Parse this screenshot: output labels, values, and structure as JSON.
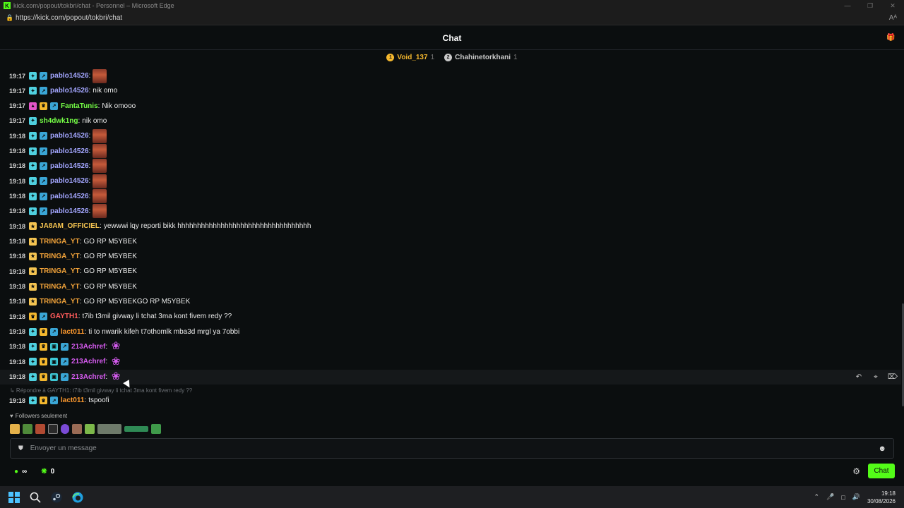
{
  "window": {
    "title": "kick.com/popout/tokbri/chat - Personnel – Microsoft Edge",
    "url": "https://kick.com/popout/tokbri/chat",
    "reader_label": "Aᴬ"
  },
  "header": {
    "title": "Chat"
  },
  "leaderboard": [
    {
      "rank": "1",
      "name": "Void_137",
      "count": "1",
      "color": "#f5b82e"
    },
    {
      "rank": "2",
      "name": "Chahinetorkhani",
      "count": "1",
      "color": "#c9c9c9"
    }
  ],
  "messages": [
    {
      "time": "19:17",
      "user": "pablo14526",
      "text": "",
      "emote": "tile",
      "badges": [
        "sub",
        "vip"
      ],
      "color": "#a3a6ff"
    },
    {
      "time": "19:17",
      "user": "pablo14526",
      "text": "nik omo",
      "emote": "",
      "badges": [
        "sub",
        "vip"
      ],
      "color": "#a3a6ff"
    },
    {
      "time": "19:17",
      "user": "FantaTunis",
      "text": "Nik omooo",
      "emote": "",
      "badges": [
        "gift",
        "crown",
        "vip"
      ],
      "color": "#75fd46"
    },
    {
      "time": "19:17",
      "user": "sh4dwk1ng",
      "text": "nik omo",
      "emote": "",
      "badges": [
        "sub"
      ],
      "color": "#75fd46"
    },
    {
      "time": "19:18",
      "user": "pablo14526",
      "text": "",
      "emote": "tile",
      "badges": [
        "sub",
        "vip"
      ],
      "color": "#a3a6ff"
    },
    {
      "time": "19:18",
      "user": "pablo14526",
      "text": "",
      "emote": "tile",
      "badges": [
        "sub",
        "vip"
      ],
      "color": "#a3a6ff"
    },
    {
      "time": "19:18",
      "user": "pablo14526",
      "text": "",
      "emote": "tile",
      "badges": [
        "sub",
        "vip"
      ],
      "color": "#a3a6ff"
    },
    {
      "time": "19:18",
      "user": "pablo14526",
      "text": "",
      "emote": "tile",
      "badges": [
        "sub",
        "vip"
      ],
      "color": "#a3a6ff"
    },
    {
      "time": "19:18",
      "user": "pablo14526",
      "text": "",
      "emote": "tile",
      "badges": [
        "sub",
        "vip"
      ],
      "color": "#a3a6ff"
    },
    {
      "time": "19:18",
      "user": "pablo14526",
      "text": "",
      "emote": "tile",
      "badges": [
        "sub",
        "vip"
      ],
      "color": "#a3a6ff"
    },
    {
      "time": "19:18",
      "user": "JA8AM_OFFICIEL",
      "text": "yewwwi lqy reporti bikk hhhhhhhhhhhhhhhhhhhhhhhhhhhhhhhhhh",
      "emote": "",
      "badges": [
        "gold"
      ],
      "color": "#f5c451"
    },
    {
      "time": "19:18",
      "user": "TRINGA_YT",
      "text": "GO RP M5YBEK",
      "emote": "",
      "badges": [
        "gold"
      ],
      "color": "#f2a33a"
    },
    {
      "time": "19:18",
      "user": "TRINGA_YT",
      "text": "GO RP M5YBEK",
      "emote": "",
      "badges": [
        "gold"
      ],
      "color": "#f2a33a"
    },
    {
      "time": "19:18",
      "user": "TRINGA_YT",
      "text": "GO RP M5YBEK",
      "emote": "",
      "badges": [
        "gold"
      ],
      "color": "#f2a33a"
    },
    {
      "time": "19:18",
      "user": "TRINGA_YT",
      "text": "GO RP M5YBEK",
      "emote": "",
      "badges": [
        "gold"
      ],
      "color": "#f2a33a"
    },
    {
      "time": "19:18",
      "user": "TRINGA_YT",
      "text": "GO RP M5YBEKGO RP M5YBEK",
      "emote": "",
      "badges": [
        "gold"
      ],
      "color": "#f2a33a"
    },
    {
      "time": "19:18",
      "user": "GAYTH1",
      "text": "t7ib t3mil givway li tchat 3ma kont fivem redy ??",
      "emote": "",
      "badges": [
        "crown",
        "vip"
      ],
      "color": "#ff5b5b"
    },
    {
      "time": "19:18",
      "user": "lact011",
      "text": "ti to nwarik kifeh t7othomlk mba3d mrgl ya 7obbi",
      "emote": "",
      "badges": [
        "sub",
        "crown",
        "vip"
      ],
      "color": "#ff9a2e"
    },
    {
      "time": "19:18",
      "user": "213Achref",
      "text": "",
      "emote": "pink",
      "badges": [
        "sub",
        "crown",
        "og",
        "vip"
      ],
      "color": "#d65bf0"
    },
    {
      "time": "19:18",
      "user": "213Achref",
      "text": "",
      "emote": "pink",
      "badges": [
        "sub",
        "crown",
        "og",
        "vip"
      ],
      "color": "#d65bf0"
    },
    {
      "time": "19:18",
      "user": "213Achref",
      "text": "",
      "emote": "pink",
      "badges": [
        "sub",
        "crown",
        "og",
        "vip"
      ],
      "color": "#d65bf0"
    }
  ],
  "reply_hint": "↳ Répondre à GAYTH1: t7ib t3mil givway li tchat 3ma kont fivem redy ??",
  "last_message": {
    "time": "19:18",
    "user": "lact011",
    "text": "tspoofi",
    "badges": [
      "sub",
      "crown",
      "vip"
    ],
    "color": "#ff9a2e"
  },
  "followers_label": "Followers seulement",
  "input": {
    "placeholder": "Envoyer un message"
  },
  "stats": {
    "viewers": "∞",
    "points": "0"
  },
  "chat_button": "Chat",
  "taskbar": {
    "time": "19:18",
    "date": "30/08/2026"
  },
  "colors": {
    "accent": "#53fc18",
    "background": "#0b0e0f"
  }
}
